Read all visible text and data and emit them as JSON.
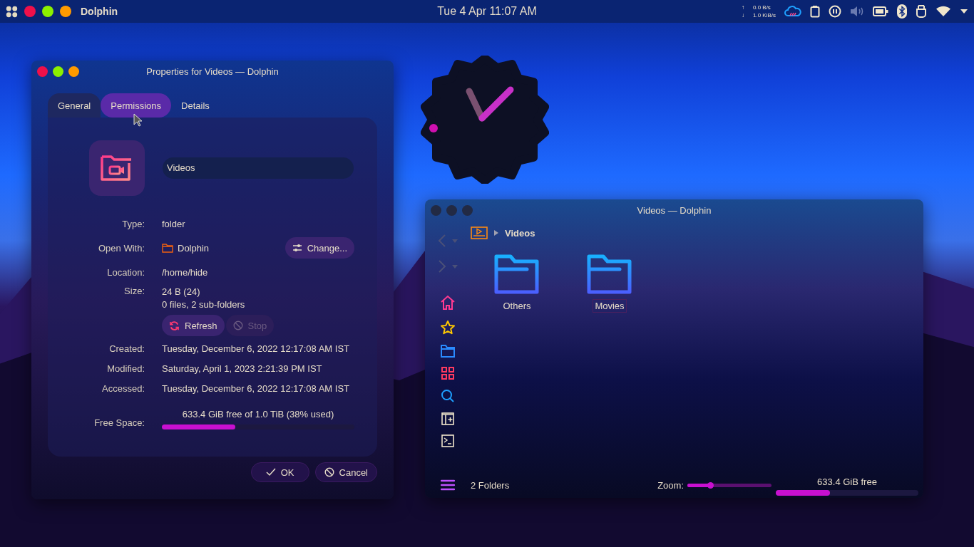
{
  "top_panel": {
    "app_name": "Dolphin",
    "clock": "Tue 4 Apr 11:07 AM",
    "upload_arrow": "↑",
    "upload": "0.0 B/s",
    "download_arrow": "↓",
    "download": "1.0 KiB/s"
  },
  "properties_window": {
    "title": "Properties for Videos — Dolphin",
    "active": true,
    "tabs": [
      {
        "label": "General",
        "selected": true,
        "hovered": false
      },
      {
        "label": "Permissions",
        "selected": false,
        "hovered": true
      },
      {
        "label": "Details",
        "selected": false,
        "hovered": false
      }
    ],
    "name_field": {
      "value": "Videos"
    },
    "type": {
      "label": "Type:",
      "value": "folder"
    },
    "open_with": {
      "label": "Open With:",
      "value": "Dolphin",
      "button": "Change..."
    },
    "location": {
      "label": "Location:",
      "value": "/home/hide"
    },
    "size": {
      "label": "Size:",
      "value": "24 B (24)",
      "detail": "0 files, 2 sub-folders"
    },
    "size_buttons": [
      {
        "kind": "refresh",
        "label": "Refresh",
        "disabled": false
      },
      {
        "kind": "stop",
        "label": "Stop",
        "disabled": true
      }
    ],
    "dates": [
      {
        "label": "Created:",
        "value": "Tuesday, December 6, 2022 12:17:08 AM IST"
      },
      {
        "label": "Modified:",
        "value": "Saturday, April 1, 2023 2:21:39 PM IST"
      },
      {
        "label": "Accessed:",
        "value": "Tuesday, December 6, 2022 12:17:08 AM IST"
      }
    ],
    "free_space": {
      "label": "Free Space:",
      "reading": "633.4 GiB free of 1.0 TiB (38% used)",
      "level": 0.38
    },
    "buttons": [
      {
        "kind": "ok",
        "label": "OK"
      },
      {
        "kind": "cancel",
        "label": "Cancel"
      }
    ]
  },
  "dolphin_window": {
    "title": "Videos — Dolphin",
    "active": false,
    "breadcrumb": "Videos",
    "folders": [
      {
        "name": "Others",
        "selected": false
      },
      {
        "name": "Movies",
        "selected": true
      }
    ],
    "status": "2 Folders",
    "zoom_label": "Zoom:",
    "zoom": {
      "level": 0.28
    },
    "free_space": {
      "reading": "633.4 GiB free",
      "level": 0.38
    }
  }
}
